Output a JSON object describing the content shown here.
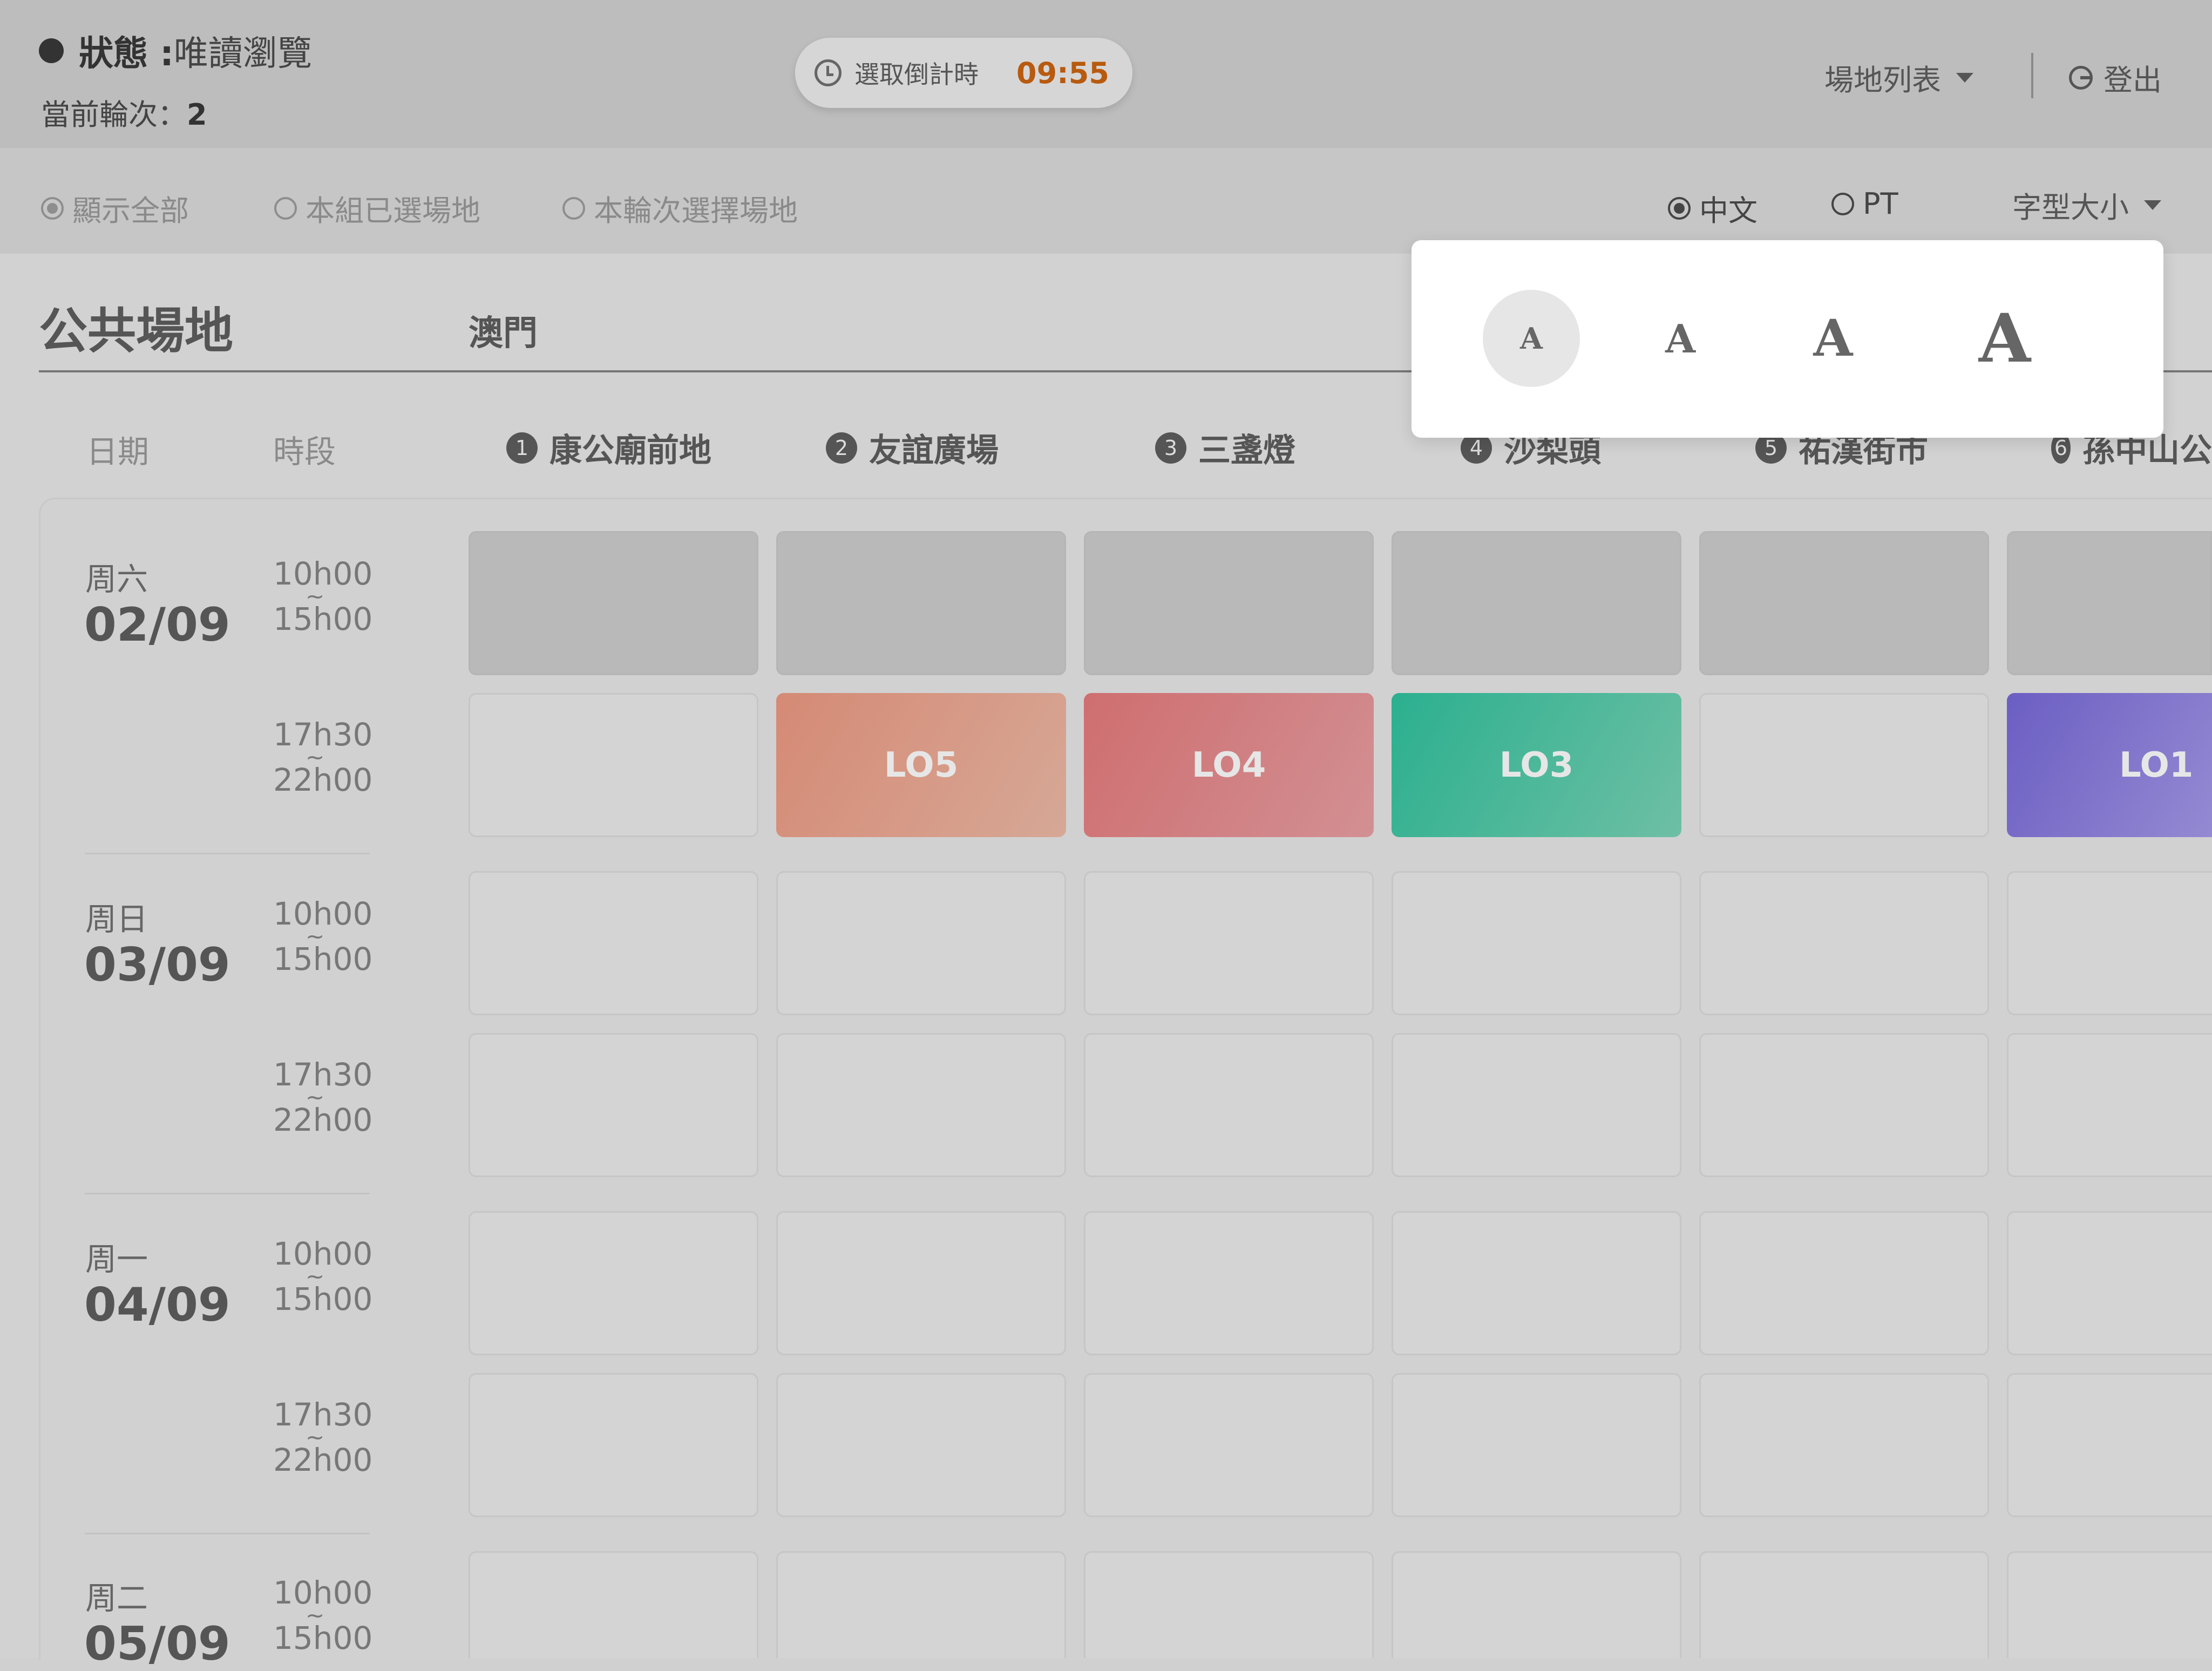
{
  "header": {
    "status_key": "狀態 :",
    "status_value": "唯讀瀏覽",
    "round_label": "當前輪次：",
    "round_value": "2",
    "countdown_label": "選取倒計時",
    "countdown_time": "09:55",
    "venue_list_label": "場地列表",
    "logout_label": "登出"
  },
  "filters": {
    "show_all": "顯示全部",
    "group_selected": "本組已選場地",
    "round_selected": "本輪次選擇場地",
    "lang_zh": "中文",
    "lang_pt": "PT",
    "font_size_label": "字型大小"
  },
  "font_size_popup": {
    "options": [
      "A",
      "A",
      "A",
      "A"
    ],
    "selected_index": 0
  },
  "section": {
    "title": "公共場地",
    "region": "澳門"
  },
  "columns": {
    "date": "日期",
    "period": "時段"
  },
  "venues": [
    {
      "num": "1",
      "name": "康公廟前地"
    },
    {
      "num": "2",
      "name": "友誼廣場"
    },
    {
      "num": "3",
      "name": "三盞燈"
    },
    {
      "num": "4",
      "name": "沙梨頭"
    },
    {
      "num": "5",
      "name": "祐漢街市"
    },
    {
      "num": "6",
      "name": "孫中山公"
    }
  ],
  "days": [
    {
      "weekday": "周六",
      "date": "02/09"
    },
    {
      "weekday": "周日",
      "date": "03/09"
    },
    {
      "weekday": "周一",
      "date": "04/09"
    },
    {
      "weekday": "周二",
      "date": "05/09"
    }
  ],
  "slots": [
    {
      "start": "10h00",
      "sep": "~",
      "end": "15h00"
    },
    {
      "start": "17h30",
      "sep": "~",
      "end": "22h00"
    }
  ],
  "booked": {
    "lo5": "LO5",
    "lo4": "LO4",
    "lo3": "LO3",
    "lo1": "LO1"
  },
  "colors": {
    "lo5": "#d58a75",
    "lo4": "#cf6e70",
    "lo3": "#2bb08f",
    "lo1": "#6b5ec3",
    "countdown": "#b85a0f"
  }
}
